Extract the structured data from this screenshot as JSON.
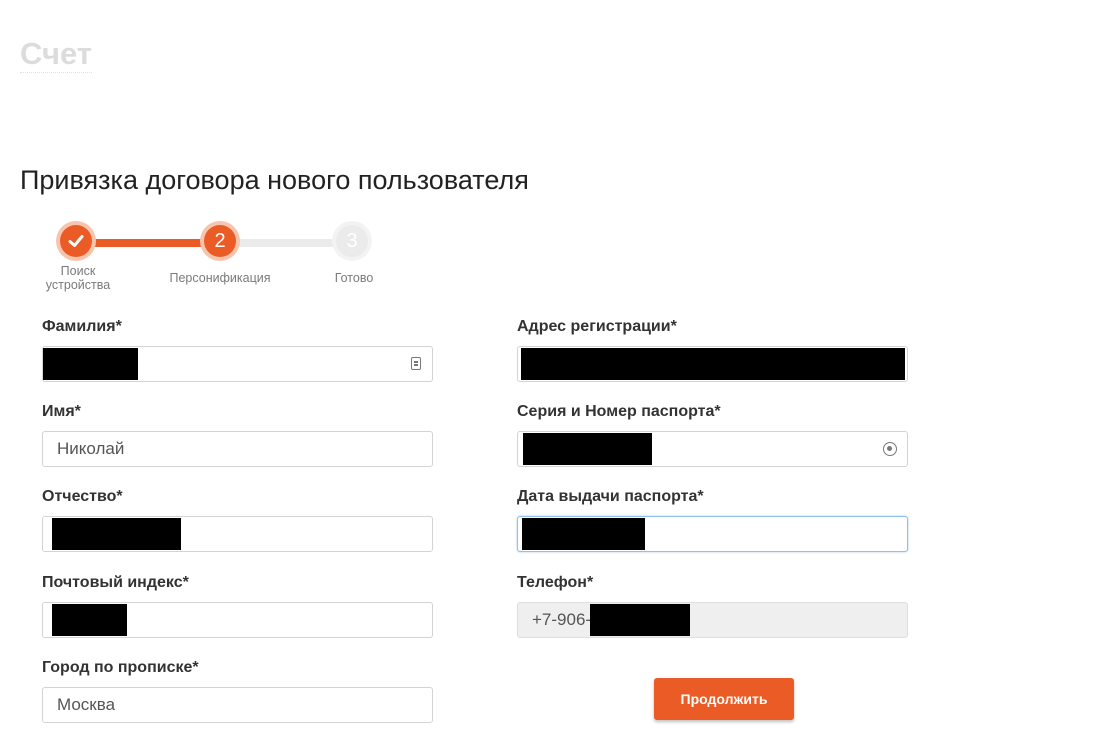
{
  "page": {
    "heading": "Счет",
    "form_title": "Привязка договора нового пользователя"
  },
  "stepper": {
    "steps": [
      {
        "number": "",
        "label": "Поиск устройства",
        "state": "done"
      },
      {
        "number": "2",
        "label": "Персонификация",
        "state": "active"
      },
      {
        "number": "3",
        "label": "Готово",
        "state": "todo"
      }
    ]
  },
  "fields": {
    "last_name": {
      "label": "Фамилия*",
      "value": ""
    },
    "first_name": {
      "label": "Имя*",
      "value": "Николай"
    },
    "patronymic": {
      "label": "Отчество*",
      "value": ""
    },
    "postal_code": {
      "label": "Почтовый индекс*",
      "value": ""
    },
    "city": {
      "label": "Город по прописке*",
      "value": "Москва"
    },
    "address": {
      "label": "Адрес регистрации*",
      "value": ""
    },
    "passport_number": {
      "label": "Серия и Номер паспорта*",
      "value": ""
    },
    "passport_date": {
      "label": "Дата выдачи паспорта*",
      "value": ""
    },
    "phone": {
      "label": "Телефон*",
      "value": "+7-906-"
    }
  },
  "actions": {
    "continue_label": "Продолжить"
  },
  "colors": {
    "accent": "#ea5b25",
    "focus_border": "#8fc1ea",
    "heading_gray": "#dcdcdc"
  },
  "icons": {
    "last_name_field": "contact-card-icon",
    "passport_field": "location-pin-icon",
    "step_done": "checkmark-icon"
  }
}
